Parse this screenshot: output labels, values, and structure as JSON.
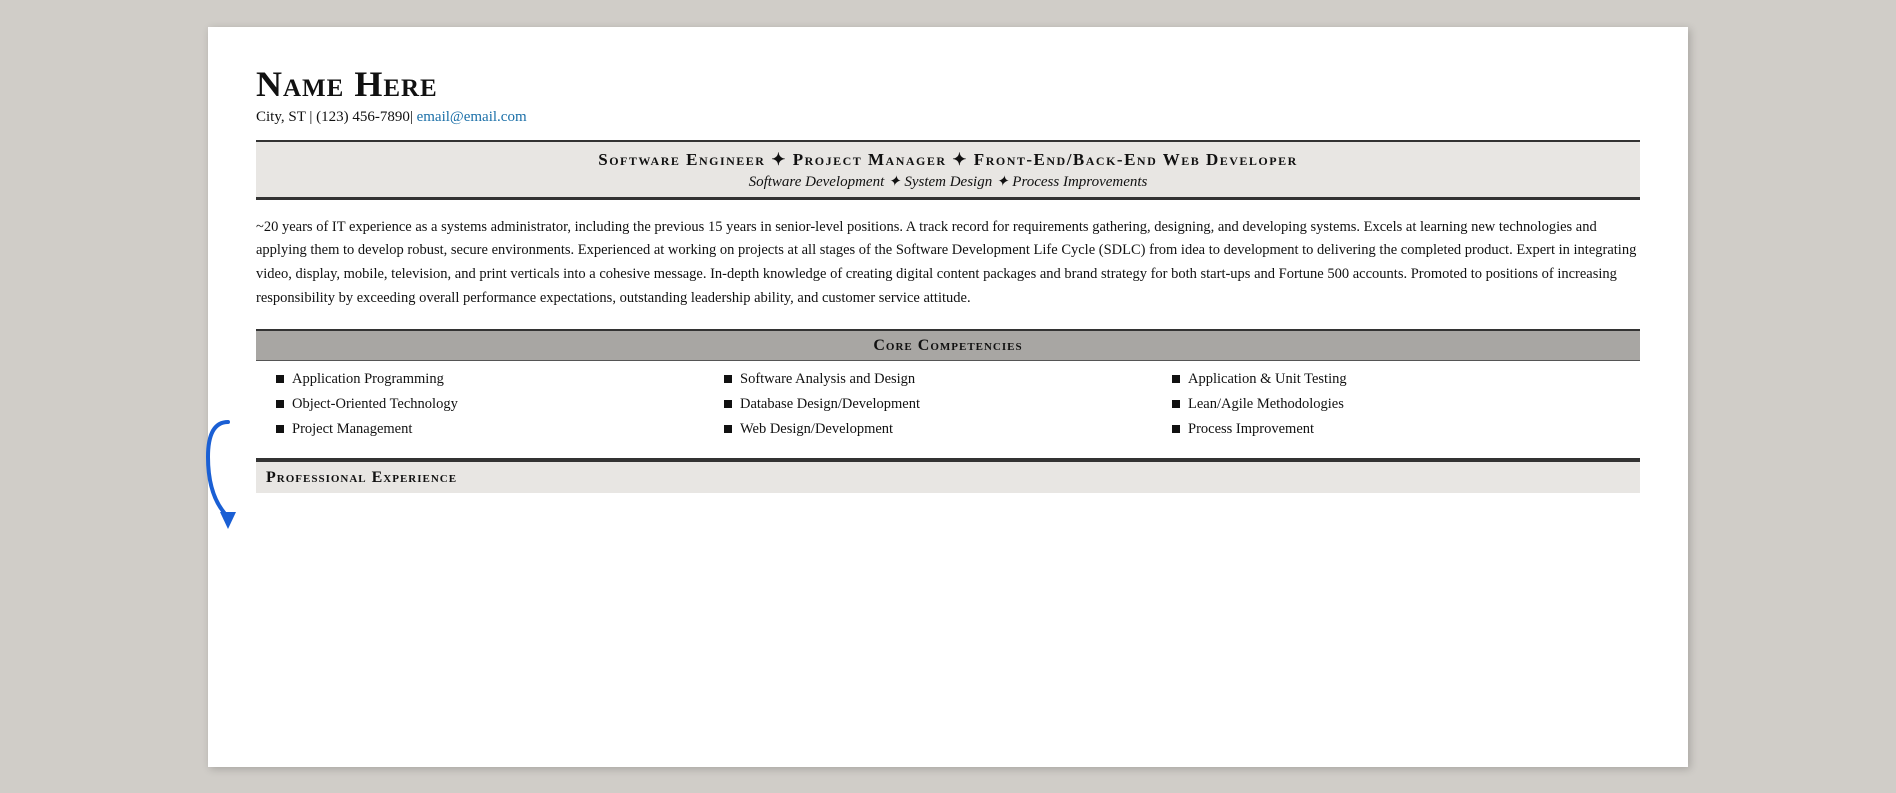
{
  "header": {
    "name": "Name Here",
    "contact": "City, ST  |  (123) 456-7890|",
    "email_text": "email@email.com",
    "email_href": "mailto:email@email.com"
  },
  "title_banner": {
    "line1": "Software Engineer ✦ Project Manager ✦ Front-End/Back-End Web Developer",
    "line2": "Software Development  ✦ System Design  ✦ Process Improvements"
  },
  "summary": {
    "text": "~20 years of IT experience as a systems administrator, including the previous 15 years in senior-level positions. A track record for requirements gathering, designing, and developing systems. Excels at learning new technologies and applying them to develop robust, secure environments. Experienced at working on projects at all stages of the Software Development Life Cycle (SDLC) from idea to development to delivering the completed product. Expert in integrating video, display, mobile, television, and print verticals into a cohesive message. In-depth knowledge of creating digital content packages and brand strategy for both start-ups and Fortune 500 accounts. Promoted to positions of increasing responsibility by exceeding overall performance expectations, outstanding leadership ability, and customer service attitude."
  },
  "core_competencies": {
    "header": "Core Competencies",
    "columns": [
      [
        "Application Programming",
        "Object-Oriented Technology",
        "Project Management"
      ],
      [
        "Software Analysis and Design",
        "Database Design/Development",
        "Web Design/Development"
      ],
      [
        "Application & Unit Testing",
        "Lean/Agile Methodologies",
        "Process Improvement"
      ]
    ]
  },
  "professional_experience": {
    "header": "Professional Experience"
  }
}
